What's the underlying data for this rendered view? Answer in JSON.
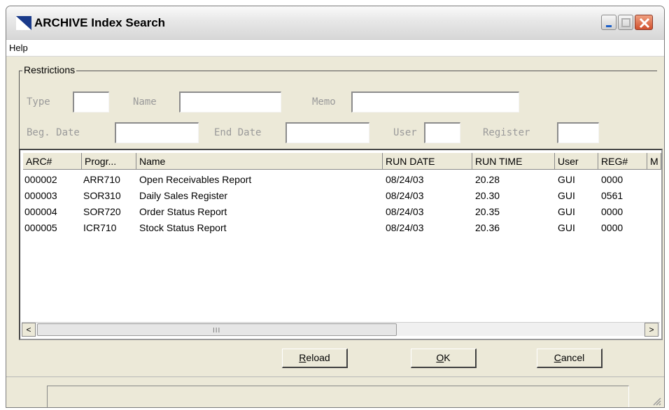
{
  "window": {
    "title": "ARCHIVE Index Search"
  },
  "menu": {
    "items": [
      {
        "label": "Help"
      }
    ]
  },
  "restrictions": {
    "legend": "Restrictions",
    "type": {
      "label": "Type",
      "value": ""
    },
    "name": {
      "label": "Name",
      "value": ""
    },
    "memo": {
      "label": "Memo",
      "value": ""
    },
    "beg_date": {
      "label": "Beg. Date",
      "value": ""
    },
    "end_date": {
      "label": "End Date",
      "value": ""
    },
    "user": {
      "label": "User",
      "value": ""
    },
    "register": {
      "label": "Register",
      "value": ""
    }
  },
  "table": {
    "columns": [
      "ARC#",
      "Progr...",
      "Name",
      "RUN DATE",
      "RUN TIME",
      "User",
      "REG#",
      "M"
    ],
    "rows": [
      {
        "arc": "000002",
        "prog": "ARR710",
        "name": "Open Receivables Report",
        "run_date": "08/24/03",
        "run_time": "20.28",
        "user": "GUI",
        "reg": "0000"
      },
      {
        "arc": "000003",
        "prog": "SOR310",
        "name": "Daily Sales Register",
        "run_date": "08/24/03",
        "run_time": "20.30",
        "user": "GUI",
        "reg": "0561"
      },
      {
        "arc": "000004",
        "prog": "SOR720",
        "name": "Order Status Report",
        "run_date": "08/24/03",
        "run_time": "20.35",
        "user": "GUI",
        "reg": "0000"
      },
      {
        "arc": "000005",
        "prog": "ICR710",
        "name": "Stock Status Report",
        "run_date": "08/24/03",
        "run_time": "20.36",
        "user": "GUI",
        "reg": "0000"
      }
    ],
    "scroll_left_glyph": "<",
    "scroll_right_glyph": ">",
    "scroll_grip": "III"
  },
  "buttons": {
    "reload": {
      "accel": "R",
      "rest": "eload"
    },
    "ok": {
      "accel": "O",
      "rest": "K"
    },
    "cancel": {
      "accel": "C",
      "rest": "ancel"
    }
  },
  "status": {
    "text": ""
  },
  "icons": {
    "app": "app-triangle-icon",
    "minimize": "minimize-icon",
    "maximize": "maximize-icon",
    "close": "close-icon",
    "resize": "resize-grip-icon"
  },
  "colors": {
    "window_bg": "#ece9d8",
    "close_btn": "#d0502e",
    "app_icon": "#1a3a8a",
    "label_gray": "#9a9a9a"
  }
}
